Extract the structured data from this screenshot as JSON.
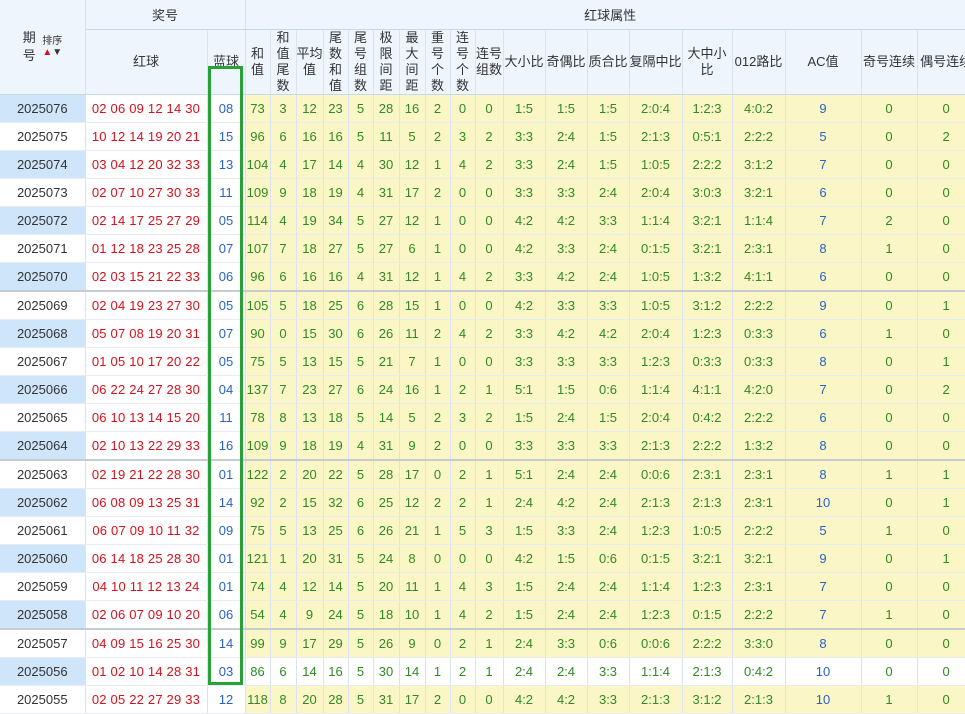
{
  "header": {
    "issue_label": "期号",
    "sort_label": "排序",
    "prize_group": "奖号",
    "red_label": "红球",
    "blue_label": "蓝球",
    "attr_group": "红球属性",
    "columns": [
      "和值",
      "和值尾数",
      "平均值",
      "尾数和值",
      "尾号组数",
      "极限间距",
      "最大间距",
      "重号个数",
      "连号个数",
      "连号组数",
      "大小比",
      "奇偶比",
      "质合比",
      "复隔中比",
      "大中小比",
      "012路比",
      "AC值",
      "奇号连续",
      "偶号连续"
    ]
  },
  "rows": [
    {
      "issue": "2025076",
      "red": "02 06 09 12 14 30",
      "blue": "08",
      "attrs": [
        "73",
        "3",
        "12",
        "23",
        "5",
        "28",
        "16",
        "2",
        "0",
        "0",
        "1:5",
        "1:5",
        "1:5",
        "2:0:4",
        "1:2:3",
        "4:0:2",
        "9",
        "0",
        "0"
      ]
    },
    {
      "issue": "2025075",
      "red": "10 12 14 19 20 21",
      "blue": "15",
      "attrs": [
        "96",
        "6",
        "16",
        "16",
        "5",
        "11",
        "5",
        "2",
        "3",
        "2",
        "3:3",
        "2:4",
        "1:5",
        "2:1:3",
        "0:5:1",
        "2:2:2",
        "5",
        "0",
        "2"
      ]
    },
    {
      "issue": "2025074",
      "red": "03 04 12 20 32 33",
      "blue": "13",
      "attrs": [
        "104",
        "4",
        "17",
        "14",
        "4",
        "30",
        "12",
        "1",
        "4",
        "2",
        "3:3",
        "2:4",
        "1:5",
        "1:0:5",
        "2:2:2",
        "3:1:2",
        "7",
        "0",
        "0"
      ]
    },
    {
      "issue": "2025073",
      "red": "02 07 10 27 30 33",
      "blue": "11",
      "attrs": [
        "109",
        "9",
        "18",
        "19",
        "4",
        "31",
        "17",
        "2",
        "0",
        "0",
        "3:3",
        "3:3",
        "2:4",
        "2:0:4",
        "3:0:3",
        "3:2:1",
        "6",
        "0",
        "0"
      ]
    },
    {
      "issue": "2025072",
      "red": "02 14 17 25 27 29",
      "blue": "05",
      "attrs": [
        "114",
        "4",
        "19",
        "34",
        "5",
        "27",
        "12",
        "1",
        "0",
        "0",
        "4:2",
        "4:2",
        "3:3",
        "1:1:4",
        "3:2:1",
        "1:1:4",
        "7",
        "2",
        "0"
      ]
    },
    {
      "issue": "2025071",
      "red": "01 12 18 23 25 28",
      "blue": "07",
      "attrs": [
        "107",
        "7",
        "18",
        "27",
        "5",
        "27",
        "6",
        "1",
        "0",
        "0",
        "4:2",
        "3:3",
        "2:4",
        "0:1:5",
        "3:2:1",
        "2:3:1",
        "8",
        "1",
        "0"
      ]
    },
    {
      "issue": "2025070",
      "red": "02 03 15 21 22 33",
      "blue": "06",
      "attrs": [
        "96",
        "6",
        "16",
        "16",
        "4",
        "31",
        "12",
        "1",
        "4",
        "2",
        "3:3",
        "4:2",
        "2:4",
        "1:0:5",
        "1:3:2",
        "4:1:1",
        "6",
        "0",
        "0"
      ],
      "grp": true
    },
    {
      "issue": "2025069",
      "red": "02 04 19 23 27 30",
      "blue": "05",
      "attrs": [
        "105",
        "5",
        "18",
        "25",
        "6",
        "28",
        "15",
        "1",
        "0",
        "0",
        "4:2",
        "3:3",
        "3:3",
        "1:0:5",
        "3:1:2",
        "2:2:2",
        "9",
        "0",
        "1"
      ]
    },
    {
      "issue": "2025068",
      "red": "05 07 08 19 20 31",
      "blue": "07",
      "attrs": [
        "90",
        "0",
        "15",
        "30",
        "6",
        "26",
        "11",
        "2",
        "4",
        "2",
        "3:3",
        "4:2",
        "4:2",
        "2:0:4",
        "1:2:3",
        "0:3:3",
        "6",
        "1",
        "0"
      ]
    },
    {
      "issue": "2025067",
      "red": "01 05 10 17 20 22",
      "blue": "05",
      "attrs": [
        "75",
        "5",
        "13",
        "15",
        "5",
        "21",
        "7",
        "1",
        "0",
        "0",
        "3:3",
        "3:3",
        "3:3",
        "1:2:3",
        "0:3:3",
        "0:3:3",
        "8",
        "0",
        "1"
      ]
    },
    {
      "issue": "2025066",
      "red": "06 22 24 27 28 30",
      "blue": "04",
      "attrs": [
        "137",
        "7",
        "23",
        "27",
        "6",
        "24",
        "16",
        "1",
        "2",
        "1",
        "5:1",
        "1:5",
        "0:6",
        "1:1:4",
        "4:1:1",
        "4:2:0",
        "7",
        "0",
        "2"
      ]
    },
    {
      "issue": "2025065",
      "red": "06 10 13 14 15 20",
      "blue": "11",
      "attrs": [
        "78",
        "8",
        "13",
        "18",
        "5",
        "14",
        "5",
        "2",
        "3",
        "2",
        "1:5",
        "2:4",
        "1:5",
        "2:0:4",
        "0:4:2",
        "2:2:2",
        "6",
        "0",
        "0"
      ]
    },
    {
      "issue": "2025064",
      "red": "02 10 13 22 29 33",
      "blue": "16",
      "attrs": [
        "109",
        "9",
        "18",
        "19",
        "4",
        "31",
        "9",
        "2",
        "0",
        "0",
        "3:3",
        "3:3",
        "3:3",
        "2:1:3",
        "2:2:2",
        "1:3:2",
        "8",
        "0",
        "0"
      ],
      "grp": true
    },
    {
      "issue": "2025063",
      "red": "02 19 21 22 28 30",
      "blue": "01",
      "attrs": [
        "122",
        "2",
        "20",
        "22",
        "5",
        "28",
        "17",
        "0",
        "2",
        "1",
        "5:1",
        "2:4",
        "2:4",
        "0:0:6",
        "2:3:1",
        "2:3:1",
        "8",
        "1",
        "1"
      ]
    },
    {
      "issue": "2025062",
      "red": "06 08 09 13 25 31",
      "blue": "14",
      "attrs": [
        "92",
        "2",
        "15",
        "32",
        "6",
        "25",
        "12",
        "2",
        "2",
        "1",
        "2:4",
        "4:2",
        "2:4",
        "2:1:3",
        "2:1:3",
        "2:3:1",
        "10",
        "0",
        "1"
      ]
    },
    {
      "issue": "2025061",
      "red": "06 07 09 10 11 32",
      "blue": "09",
      "attrs": [
        "75",
        "5",
        "13",
        "25",
        "6",
        "26",
        "21",
        "1",
        "5",
        "3",
        "1:5",
        "3:3",
        "2:4",
        "1:2:3",
        "1:0:5",
        "2:2:2",
        "5",
        "1",
        "0"
      ]
    },
    {
      "issue": "2025060",
      "red": "06 14 18 25 28 30",
      "blue": "01",
      "attrs": [
        "121",
        "1",
        "20",
        "31",
        "5",
        "24",
        "8",
        "0",
        "0",
        "0",
        "4:2",
        "1:5",
        "0:6",
        "0:1:5",
        "3:2:1",
        "3:2:1",
        "9",
        "0",
        "1"
      ]
    },
    {
      "issue": "2025059",
      "red": "04 10 11 12 13 24",
      "blue": "01",
      "attrs": [
        "74",
        "4",
        "12",
        "14",
        "5",
        "20",
        "11",
        "1",
        "4",
        "3",
        "1:5",
        "2:4",
        "2:4",
        "1:1:4",
        "1:2:3",
        "2:3:1",
        "7",
        "0",
        "0"
      ]
    },
    {
      "issue": "2025058",
      "red": "02 06 07 09 10 20",
      "blue": "06",
      "attrs": [
        "54",
        "4",
        "9",
        "24",
        "5",
        "18",
        "10",
        "1",
        "4",
        "2",
        "1:5",
        "2:4",
        "2:4",
        "1:2:3",
        "0:1:5",
        "2:2:2",
        "7",
        "1",
        "0"
      ],
      "grp": true
    },
    {
      "issue": "2025057",
      "red": "04 09 15 16 25 30",
      "blue": "14",
      "attrs": [
        "99",
        "9",
        "17",
        "29",
        "5",
        "26",
        "9",
        "0",
        "2",
        "1",
        "2:4",
        "3:3",
        "0:6",
        "0:0:6",
        "2:2:2",
        "3:3:0",
        "8",
        "0",
        "0"
      ]
    },
    {
      "issue": "2025056",
      "red": "01 02 10 14 28 31",
      "blue": "03",
      "attrs": [
        "86",
        "6",
        "14",
        "16",
        "5",
        "30",
        "14",
        "1",
        "2",
        "1",
        "2:4",
        "2:4",
        "3:3",
        "1:1:4",
        "2:1:3",
        "0:4:2",
        "10",
        "0",
        "0"
      ],
      "white": true
    },
    {
      "issue": "2025055",
      "red": "02 05 22 27 29 33",
      "blue": "12",
      "attrs": [
        "118",
        "8",
        "20",
        "28",
        "5",
        "31",
        "17",
        "2",
        "0",
        "0",
        "4:2",
        "4:2",
        "3:3",
        "2:1:3",
        "3:1:2",
        "2:1:3",
        "10",
        "1",
        "0"
      ]
    }
  ]
}
